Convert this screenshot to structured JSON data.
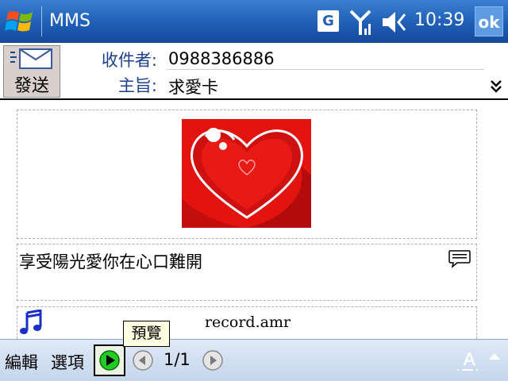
{
  "titlebar": {
    "app_title": "MMS",
    "g_badge": "G",
    "clock": "10:39",
    "ok_label": "ok"
  },
  "header": {
    "send_label": "發送",
    "to_label": "收件者:",
    "to_value": "0988386886",
    "subject_label": "主旨:",
    "subject_value": "求愛卡"
  },
  "slide": {
    "message_text": "享受陽光愛你在心口難開",
    "audio_file": "record.amr"
  },
  "toolbar": {
    "edit_label": "編輯",
    "options_label": "選項",
    "page_counter": "1/1",
    "font_button_label": "A",
    "tooltip": "預覽"
  },
  "colors": {
    "titlebar": "#1f5fb6",
    "label_blue": "#1c3f8a",
    "heart_red": "#e3140f",
    "play_green": "#22cc22",
    "toolbar": "#d3e0f1"
  }
}
